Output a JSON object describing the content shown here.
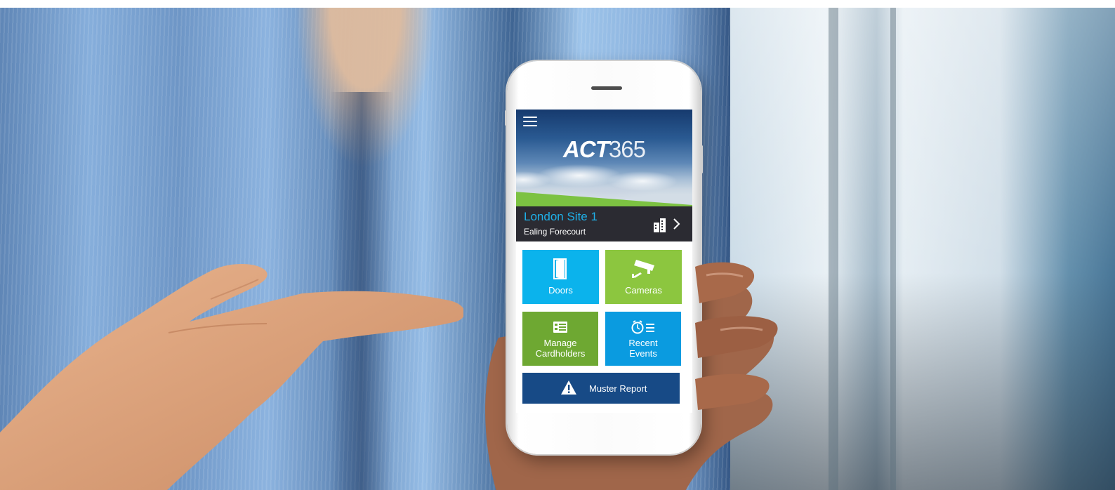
{
  "app": {
    "logo": {
      "part1": "ACT",
      "part2": "365"
    },
    "menu_icon": "hamburger-menu-icon"
  },
  "site": {
    "name": "London Site 1",
    "location": "Ealing Forecourt",
    "icons": [
      "building-icon",
      "chevron-right-icon"
    ]
  },
  "tiles": [
    {
      "label": "Doors",
      "icon": "door-icon",
      "color": "#0bb3ec"
    },
    {
      "label": "Cameras",
      "icon": "camera-icon",
      "color": "#8cc63f"
    },
    {
      "label_line1": "Manage",
      "label_line2": "Cardholders",
      "icon": "id-card-icon",
      "color": "#6ea832"
    },
    {
      "label_line1": "Recent",
      "label_line2": "Events",
      "icon": "clock-list-icon",
      "color": "#0a9be0"
    }
  ],
  "muster": {
    "label": "Muster Report",
    "icon": "warning-icon",
    "color": "#174a86"
  },
  "colors": {
    "site_name": "#1fb0e8",
    "site_bar": "#2b2b32",
    "grass": "#7cc242"
  }
}
